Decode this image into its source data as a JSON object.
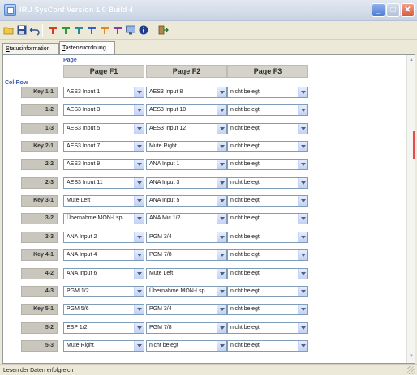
{
  "window": {
    "title": "IRU SysConf Version 1.0 Build 4"
  },
  "tabs": [
    {
      "label": "Statusinformation",
      "underline": "S",
      "rest": "tatusinformation"
    },
    {
      "label": "Tastenzuordnung",
      "underline": "T",
      "rest": "astenzuordnung"
    }
  ],
  "grid": {
    "page_caption": "Page",
    "colrow_caption": "Col-Row",
    "columns": [
      "Page F1",
      "Page F2",
      "Page F3"
    ],
    "rows": [
      {
        "key": "Key 1-1",
        "cells": [
          "AES3 Input 1",
          "AES3 Input 8",
          "nicht belegt"
        ]
      },
      {
        "key": "1-2",
        "cells": [
          "AES3 Input 3",
          "AES3 Input 10",
          "nicht belegt"
        ]
      },
      {
        "key": "1-3",
        "cells": [
          "AES3 Input 5",
          "AES3 Input 12",
          "nicht belegt"
        ]
      },
      {
        "key": "Key 2-1",
        "cells": [
          "AES3 Input 7",
          "Mute Right",
          "nicht belegt"
        ]
      },
      {
        "key": "2-2",
        "cells": [
          "AES3 Input 9",
          "ANA Input 1",
          "nicht belegt"
        ]
      },
      {
        "key": "2-3",
        "cells": [
          "AES3 Input 11",
          "ANA Input 3",
          "nicht belegt"
        ]
      },
      {
        "key": "Key 3-1",
        "cells": [
          "Mute Left",
          "ANA Input 5",
          "nicht belegt"
        ]
      },
      {
        "key": "3-2",
        "cells": [
          "Übernahme MON-Lsp",
          "ANA Mic 1/2",
          "nicht belegt"
        ]
      },
      {
        "key": "3-3",
        "cells": [
          "ANA Input 2",
          "PGM 3/4",
          "nicht belegt"
        ]
      },
      {
        "key": "Key 4-1",
        "cells": [
          "ANA Input 4",
          "PGM 7/8",
          "nicht belegt"
        ]
      },
      {
        "key": "4-2",
        "cells": [
          "ANA Input 6",
          "Mute Left",
          "nicht belegt"
        ]
      },
      {
        "key": "4-3",
        "cells": [
          "PGM 1/2",
          "Übernahme MON-Lsp",
          "nicht belegt"
        ]
      },
      {
        "key": "Key 5-1",
        "cells": [
          "PGM 5/6",
          "PGM 3/4",
          "nicht belegt"
        ]
      },
      {
        "key": "5-2",
        "cells": [
          "ESP 1/2",
          "PGM 7/8",
          "nicht belegt"
        ]
      },
      {
        "key": "5-3",
        "cells": [
          "Mute Right",
          "nicht belegt",
          "nicht belegt"
        ]
      }
    ]
  },
  "status": {
    "text": "Lesen der Daten erfolgreich"
  }
}
